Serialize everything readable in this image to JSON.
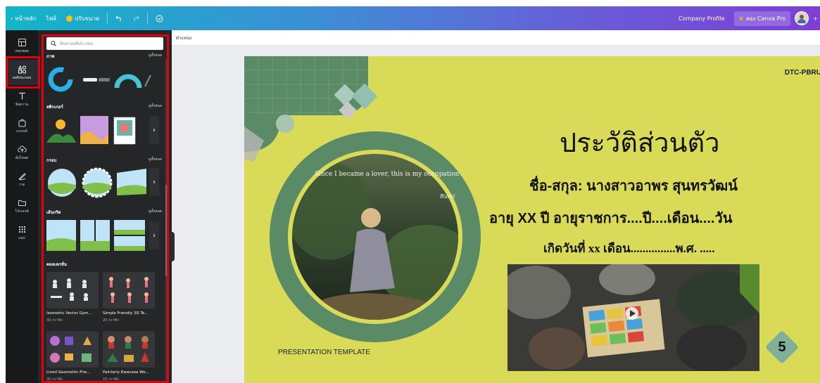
{
  "topbar": {
    "back_label": "หน้าหลัก",
    "file_label": "ไฟล์",
    "resize_label": "ปรับขนาด",
    "project_name": "Company Profile",
    "try_pro_label": "ลอง Canva Pro"
  },
  "rail": {
    "items": [
      {
        "label": "เทมเพลต",
        "icon": "template-icon"
      },
      {
        "label": "องค์ประกอบ",
        "icon": "elements-icon"
      },
      {
        "label": "ข้อความ",
        "icon": "text-icon"
      },
      {
        "label": "แบรนด์",
        "icon": "brand-icon"
      },
      {
        "label": "อัปโหลด",
        "icon": "upload-icon"
      },
      {
        "label": "วาด",
        "icon": "draw-icon"
      },
      {
        "label": "โปรเจกต์",
        "icon": "folder-icon"
      },
      {
        "label": "แอป",
        "icon": "apps-icon"
      }
    ]
  },
  "panel": {
    "search_placeholder": "ค้นหาองค์ประกอบ",
    "see_all": "ดูทั้งหมด",
    "sections": [
      "ภาพ",
      "สติกเกอร์",
      "กรอบ",
      "เส้นกริด",
      "คอลเลกชั่น"
    ],
    "collections": [
      {
        "title": "Isometric Vector Gym...",
        "count": "30 กราฟิก"
      },
      {
        "title": "Simple Friendly 3D Te...",
        "count": "20 กราฟิก"
      },
      {
        "title": "Lined Geometric Frie...",
        "count": "30 กราฟิก"
      },
      {
        "title": "Painterly Kwanzaa Wo...",
        "count": "15 กราฟิก"
      }
    ]
  },
  "canvas": {
    "toolbar_label": "ตำแหน่ง"
  },
  "slide": {
    "brand": "DTC-PBRU",
    "title": "ประวัติส่วนตัว",
    "name_line": "ชื่อ-สกุล: นางสาวอาพร สุนทรวัฒน์",
    "age_line": "อายุ  XX  ปี อายุราชการ....ปี....เดือน....วัน",
    "birth_line": "เกิดวันที่ xx เดือน...............พ.ศ. .....",
    "presentation_label": "PRESENTATION TEMPLATE",
    "page_number": "5",
    "photo_quote": "Since I became a lover, this is my occupation",
    "photo_author": "Rumi"
  },
  "colors": {
    "slide_bg": "#d9db58",
    "circle_ring": "#5b8a67",
    "accent_tile": "#7fae99",
    "rail_bg": "#18191b",
    "panel_bg": "#252627",
    "highlight": "#e3000f"
  }
}
